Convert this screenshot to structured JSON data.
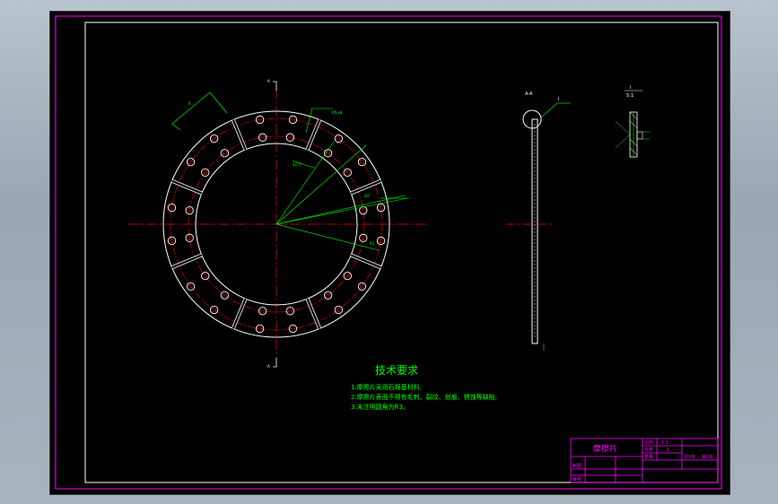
{
  "drawing": {
    "section_mark_top": "A",
    "section_mark_bottom": "A",
    "section_label": "A-A",
    "detail_label": "I",
    "detail_scale": "5:1",
    "technical_requirements": {
      "title": "技术要求",
      "items": [
        "1.摩擦片采用石棉基材料;",
        "2.摩擦片表面不得有毛刺、裂纹、划痕、锈蚀等缺陷;",
        "3.未注明圆角为R3。"
      ]
    },
    "title_block": {
      "part_name": "摩擦片",
      "scale_label": "比例",
      "scale_value": "1:1",
      "quantity_label": "件数",
      "quantity_value": "1",
      "weight_label": "重量",
      "sheet_label": "共1张",
      "sheet_value": "第1张",
      "drawn_label": "制图",
      "checked_label": "审核"
    }
  },
  "colors": {
    "background": "#000000",
    "frame": "#ff00ff",
    "outline": "#ffffff",
    "centerline": "#ff0000",
    "dimension": "#00ff00"
  }
}
